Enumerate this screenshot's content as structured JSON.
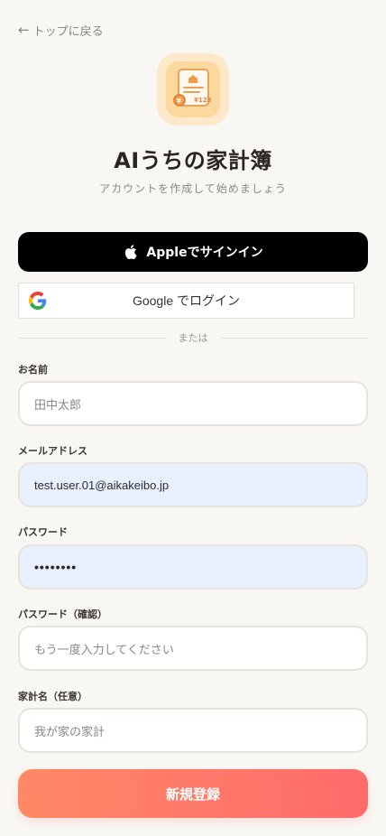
{
  "nav": {
    "back_label": "トップに戻る"
  },
  "app": {
    "title": "AIうちの家計簿",
    "subtitle": "アカウントを作成して始めましょう",
    "logo_amount": "¥123"
  },
  "auth": {
    "apple_label": "Appleでサインイン",
    "google_label": "Google でログイン",
    "divider_text": "または"
  },
  "form": {
    "name": {
      "label": "お名前",
      "placeholder": "田中太郎"
    },
    "email": {
      "label": "メールアドレス",
      "value": "test.user.01@aikakeibo.jp"
    },
    "password": {
      "label": "パスワード",
      "value": "••••••••"
    },
    "password_confirm": {
      "label": "パスワード（確認）",
      "placeholder": "もう一度入力してください"
    },
    "household": {
      "label": "家計名（任意）",
      "placeholder": "我が家の家計"
    },
    "submit_label": "新規登録"
  },
  "colors": {
    "background": "#f9f7f3",
    "accent_start": "#ff8866",
    "accent_end": "#ff6b6b",
    "autofill": "#e8f0fe"
  }
}
